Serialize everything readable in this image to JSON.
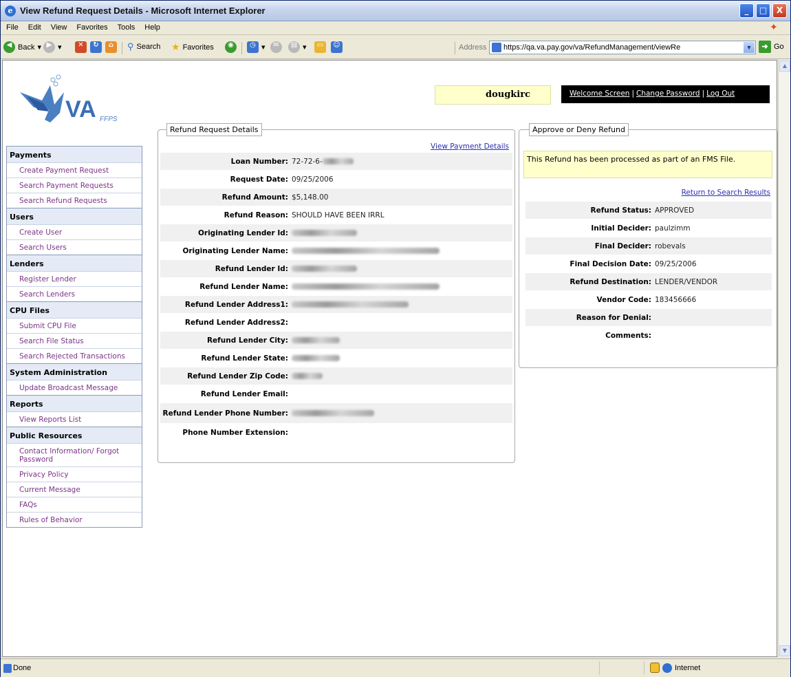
{
  "window": {
    "title": "View Refund Request Details - Microsoft Internet Explorer",
    "min_glyph": "_",
    "max_glyph": "□",
    "close_glyph": "X"
  },
  "menu": {
    "items": [
      "File",
      "Edit",
      "View",
      "Favorites",
      "Tools",
      "Help"
    ]
  },
  "toolbar": {
    "back_label": "Back",
    "search_label": "Search",
    "favorites_label": "Favorites",
    "address_label": "Address",
    "url": "https://qa.va.pay.gov/va/RefundManagement/viewRe",
    "go_label": "Go"
  },
  "logo": {
    "text": "VA",
    "sub": "FFPS"
  },
  "nav": {
    "sections": [
      {
        "title": "Payments",
        "items": [
          "Create Payment Request",
          "Search Payment Requests",
          "Search Refund Requests"
        ]
      },
      {
        "title": "Users",
        "items": [
          "Create User",
          "Search Users"
        ]
      },
      {
        "title": "Lenders",
        "items": [
          "Register Lender",
          "Search Lenders"
        ]
      },
      {
        "title": "CPU Files",
        "items": [
          "Submit CPU File",
          "Search File Status",
          "Search Rejected Transactions"
        ]
      },
      {
        "title": "System Administration",
        "items": [
          "Update Broadcast Message"
        ]
      },
      {
        "title": "Reports",
        "items": [
          "View Reports List"
        ]
      },
      {
        "title": "Public Resources",
        "items": [
          "Contact Information/ Forgot Password",
          "Privacy Policy",
          "Current Message",
          "FAQs",
          "Rules of Behavior"
        ]
      }
    ]
  },
  "header": {
    "username": "dougkirc",
    "welcome_link": "Welcome Screen",
    "change_password_link": "Change Password",
    "logout_link": "Log Out",
    "separator": "|"
  },
  "details": {
    "legend": "Refund Request Details",
    "view_payment_link": "View Payment Details",
    "rows": [
      {
        "label": "Loan Number:",
        "value": "72-72-6-"
      },
      {
        "label": "Request Date:",
        "value": "09/25/2006"
      },
      {
        "label": "Refund Amount:",
        "value": "$5,148.00"
      },
      {
        "label": "Refund Reason:",
        "value": "SHOULD HAVE BEEN IRRL"
      },
      {
        "label": "Originating Lender Id:",
        "value": ""
      },
      {
        "label": "Originating Lender Name:",
        "value": ""
      },
      {
        "label": "Refund Lender Id:",
        "value": ""
      },
      {
        "label": "Refund Lender Name:",
        "value": ""
      },
      {
        "label": "Refund Lender Address1:",
        "value": ""
      },
      {
        "label": "Refund Lender Address2:",
        "value": ""
      },
      {
        "label": "Refund Lender City:",
        "value": ""
      },
      {
        "label": "Refund Lender State:",
        "value": ""
      },
      {
        "label": "Refund Lender Zip Code:",
        "value": ""
      },
      {
        "label": "Refund Lender Email:",
        "value": ""
      },
      {
        "label": "Refund Lender Phone Number:",
        "value": ""
      },
      {
        "label": "Phone Number Extension:",
        "value": ""
      }
    ]
  },
  "decision": {
    "legend": "Approve or Deny Refund",
    "notice": "This Refund has been processed as part of an FMS File.",
    "return_link": "Return to Search Results",
    "rows": [
      {
        "label": "Refund Status:",
        "value": "APPROVED"
      },
      {
        "label": "Initial Decider:",
        "value": "paulzimm"
      },
      {
        "label": "Final Decider:",
        "value": "robevals"
      },
      {
        "label": "Final Decision Date:",
        "value": "09/25/2006"
      },
      {
        "label": "Refund Destination:",
        "value": "LENDER/VENDOR"
      },
      {
        "label": "Vendor Code:",
        "value": "183456666"
      },
      {
        "label": "Reason for Denial:",
        "value": ""
      },
      {
        "label": "Comments:",
        "value": ""
      }
    ]
  },
  "status": {
    "text": "Done",
    "zone": "Internet"
  }
}
